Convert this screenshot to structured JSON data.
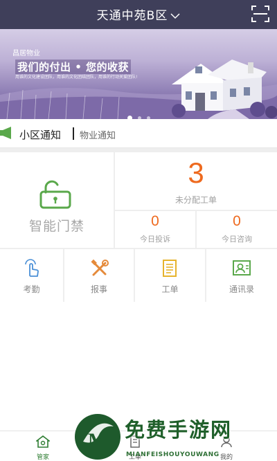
{
  "header": {
    "title": "天通中苑B区",
    "scan_icon": "scan-icon"
  },
  "banner": {
    "brand": "昌居物业",
    "slogan": "我们的付出 • 您的收获",
    "subtitle": "用谁的文化建设团队，用谁的文化团结团队，用谁的行动关爱团队!",
    "slide_count": 3,
    "active_slide": 1
  },
  "notice": {
    "tabs": [
      {
        "label": "小区通知",
        "active": true
      },
      {
        "label": "物业通知",
        "active": false
      }
    ],
    "icon": "megaphone-icon"
  },
  "grid": {
    "door": {
      "label": "智能门禁",
      "icon": "unlock-icon"
    },
    "unassigned": {
      "count": "3",
      "label": "未分配工单"
    },
    "complaint": {
      "count": "0",
      "label": "今日投诉"
    },
    "consult": {
      "count": "0",
      "label": "今日咨询"
    }
  },
  "functions": [
    {
      "label": "考勤",
      "icon": "tap-hand-icon"
    },
    {
      "label": "报事",
      "icon": "tools-icon"
    },
    {
      "label": "工单",
      "icon": "document-icon"
    },
    {
      "label": "通讯录",
      "icon": "contacts-icon"
    }
  ],
  "bottom_nav": [
    {
      "label": "管家",
      "icon": "home-icon",
      "active": true
    },
    {
      "label": "工单",
      "icon": "document-icon",
      "active": false
    },
    {
      "label": "",
      "icon": "center-icon",
      "active": false
    },
    {
      "label": "我的",
      "icon": "user-icon",
      "active": false
    }
  ],
  "watermark": {
    "title": "免费手游网",
    "subtitle": "MIANFEISHOUYOUWANG"
  },
  "colors": {
    "header_bg": "#3f3f5a",
    "accent_orange": "#ee6a1f",
    "accent_green": "#5aa84b",
    "icon_orange": "#e58a3a",
    "icon_blue": "#4a8fd6",
    "icon_yellow": "#e6b32c"
  }
}
